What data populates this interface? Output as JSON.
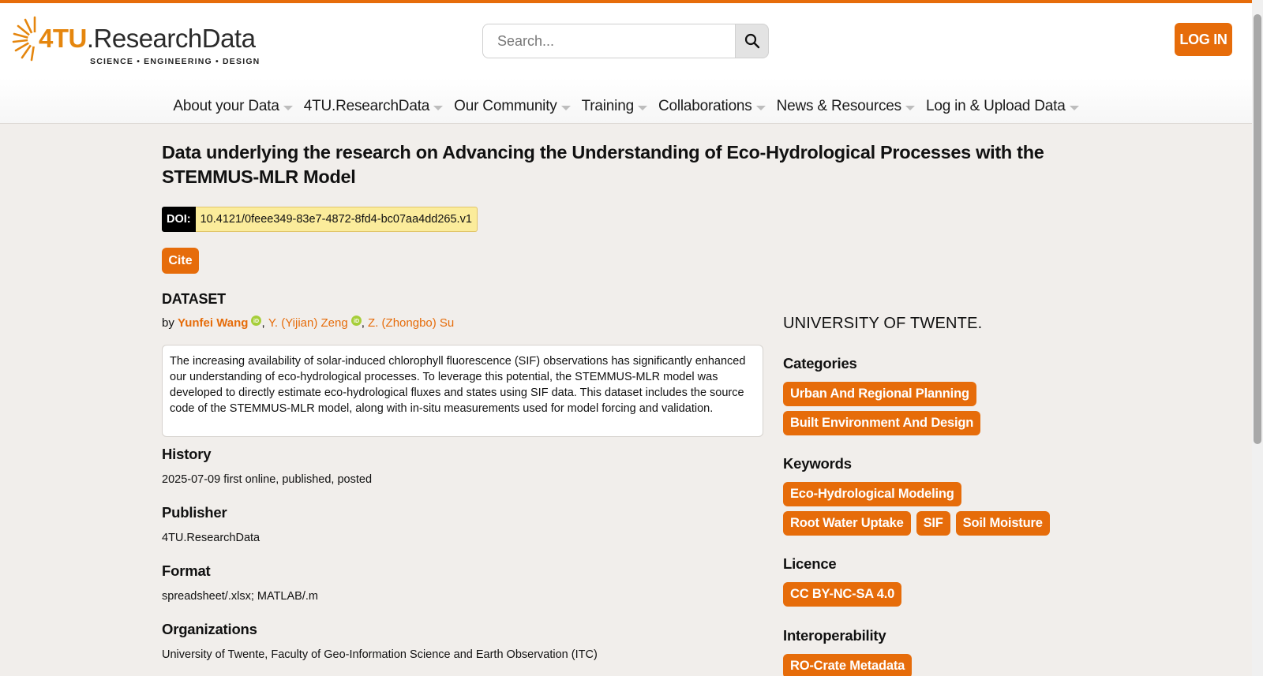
{
  "header": {
    "logo": {
      "main_a": "4TU",
      "main_b": ".ResearchData",
      "tagline": "SCIENCE • ENGINEERING • DESIGN"
    },
    "search": {
      "placeholder": "Search..."
    },
    "login_label": "LOG IN"
  },
  "nav": {
    "items": [
      "About your Data",
      "4TU.ResearchData",
      "Our Community",
      "Training",
      "Collaborations",
      "News & Resources",
      "Log in & Upload Data"
    ]
  },
  "dataset": {
    "title": "Data underlying the research on Advancing the Understanding of Eco-Hydrological Processes with the STEMMUS-MLR Model",
    "doi_label": "DOI:",
    "doi_value": "10.4121/0feee349-83e7-4872-8fd4-bc07aa4dd265.v1",
    "cite_label": "Cite",
    "type_label": "DATASET",
    "by_label": "by",
    "authors": [
      "Yunfei Wang",
      "Y. (Yijian) Zeng",
      "Z. (Zhongbo) Su"
    ],
    "abstract": "The increasing availability of solar-induced chlorophyll fluorescence (SIF) observations has significantly enhanced our understanding of eco-hydrological processes. To leverage this potential, the STEMMUS-MLR model was developed to directly estimate eco-hydrological fluxes and states using SIF data. This dataset includes the source code of the STEMMUS-MLR model, along with in-situ measurements used for model forcing and validation.",
    "history": {
      "heading": "History",
      "value": "2025-07-09 first online, published, posted"
    },
    "publisher": {
      "heading": "Publisher",
      "value": "4TU.ResearchData"
    },
    "format": {
      "heading": "Format",
      "value": "spreadsheet/.xlsx; MATLAB/.m"
    },
    "organizations": {
      "heading": "Organizations",
      "value": "University of Twente, Faculty of Geo-Information Science and Earth Observation (ITC)"
    }
  },
  "sidebar": {
    "institution": "UNIVERSITY OF TWENTE.",
    "categories": {
      "heading": "Categories",
      "items": [
        "Urban And Regional Planning",
        "Built Environment And Design"
      ]
    },
    "keywords": {
      "heading": "Keywords",
      "items": [
        "Eco-Hydrological Modeling",
        "Root Water Uptake",
        "SIF",
        "Soil Moisture"
      ]
    },
    "licence": {
      "heading": "Licence",
      "items": [
        "CC BY-NC-SA 4.0"
      ]
    },
    "interoperability": {
      "heading": "Interoperability",
      "items": [
        "RO-Crate Metadata"
      ]
    }
  },
  "colors": {
    "accent": "#e66c0a",
    "doi_bg": "#fbec9b",
    "orcid": "#a6ce39",
    "background": "#f1eeeb"
  }
}
